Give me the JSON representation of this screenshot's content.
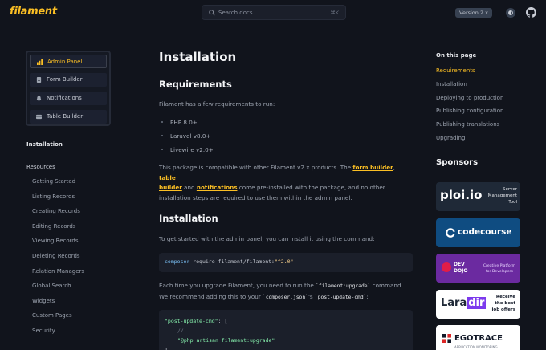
{
  "header": {
    "logo": "filament",
    "search_placeholder": "Search docs",
    "search_shortcut": "⌘K",
    "version": "Version 2.x"
  },
  "packages": [
    {
      "label": "Admin Panel",
      "icon": "bar-chart-icon",
      "active": true
    },
    {
      "label": "Form Builder",
      "icon": "document-icon",
      "active": false
    },
    {
      "label": "Notifications",
      "icon": "bell-icon",
      "active": false
    },
    {
      "label": "Table Builder",
      "icon": "table-icon",
      "active": false
    }
  ],
  "nav": {
    "installation": "Installation",
    "resources": "Resources",
    "items": [
      "Getting Started",
      "Listing Records",
      "Creating Records",
      "Editing Records",
      "Viewing Records",
      "Deleting Records",
      "Relation Managers",
      "Global Search",
      "Widgets",
      "Custom Pages",
      "Security"
    ]
  },
  "main": {
    "title": "Installation",
    "requirements_heading": "Requirements",
    "requirements_intro": "Filament has a few requirements to run:",
    "requirements": [
      "PHP 8.0+",
      "Laravel v8.0+",
      "Livewire v2.0+"
    ],
    "compat_1": "This package is compatible with other Filament v2.x products. The ",
    "compat_link_form": "form builder",
    "compat_2": ", ",
    "compat_link_table_1": "table",
    "compat_link_table_2": "builder",
    "compat_3": " and ",
    "compat_link_notifications": "notifications",
    "compat_4": " come pre-installed with the package, and no other",
    "compat_5": "installation steps are required to use them within the admin panel.",
    "installation_heading": "Installation",
    "install_intro": "To get started with the admin panel, you can install it using the command:",
    "install_cmd_bin": "composer",
    "install_cmd_rest": " require filament/filament:",
    "install_cmd_ver": "\"^2.0\"",
    "upgrade_1": "Each time you upgrade Filament, you need to run the ",
    "upgrade_code_1": "`filament:upgrade`",
    "upgrade_2": " command.",
    "upgrade_3": "We recommend adding this to your ",
    "upgrade_code_2": "`composer.json`",
    "upgrade_4": "'s ",
    "upgrade_code_3": "`post-update-cmd`",
    "upgrade_5": ":",
    "code_line_1_key": "\"post-update-cmd\"",
    "code_line_1_rest": ": [",
    "code_line_2": "// ...",
    "code_line_3": "\"@php artisan filament:upgrade\"",
    "code_line_4": "],"
  },
  "toc": {
    "title": "On this page",
    "items": [
      "Requirements",
      "Installation",
      "Deploying to production",
      "Publishing configuration",
      "Publishing translations",
      "Upgrading"
    ],
    "active_index": 0
  },
  "sponsors": {
    "title": "Sponsors",
    "ploi_name": "ploi.io",
    "ploi_tag_1": "Server",
    "ploi_tag_2": "Management",
    "ploi_tag_3": "Tool",
    "codecourse": "codecourse",
    "devdojo_1": "DEV",
    "devdojo_2": "DOJO",
    "devdojo_tag_1": "Creative Platform",
    "devdojo_tag_2": "for Developers",
    "laradir_1": "Lara",
    "laradir_2": "dir",
    "laradir_tag_1": "Receive",
    "laradir_tag_2": "the best",
    "laradir_tag_3": "job offers",
    "egotrace": "EGOTRACE",
    "egotrace_sub": "APPLICATION MONITORING"
  },
  "colors": {
    "background": "#11141c",
    "accent": "#fbbf24",
    "codecourse_bg": "#0f4c81",
    "devdojo_bg": "#6b2aa0"
  }
}
